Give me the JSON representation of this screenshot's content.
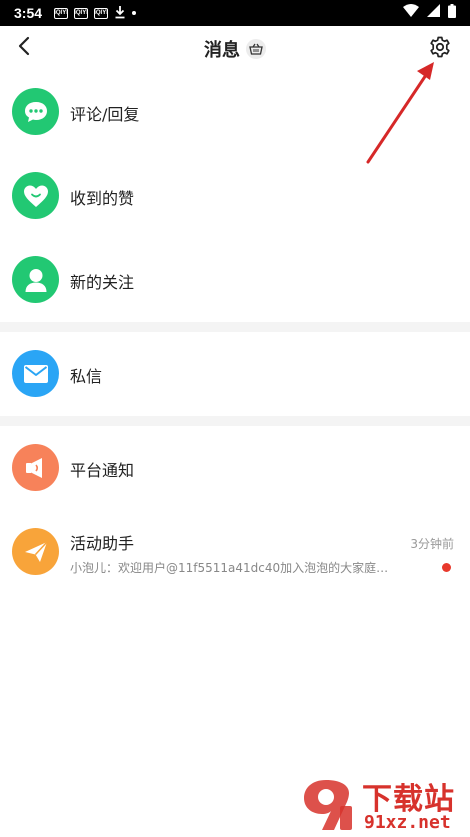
{
  "status_bar": {
    "time": "3:54",
    "app_icons": [
      "iQIYI",
      "iQIYI",
      "iQIYI"
    ],
    "download_icon": "download-icon",
    "icons": [
      "wifi-icon",
      "signal-icon",
      "battery-icon"
    ]
  },
  "header": {
    "title": "消息",
    "back_icon": "chevron-left-icon",
    "badge_icon": "basket-icon",
    "settings_icon": "gear-icon"
  },
  "rows": [
    {
      "label": "评论/回复",
      "icon": "comment-icon",
      "color": "#22c873"
    },
    {
      "label": "收到的赞",
      "icon": "heart-icon",
      "color": "#22c873"
    },
    {
      "label": "新的关注",
      "icon": "person-icon",
      "color": "#22c873"
    },
    {
      "label": "私信",
      "icon": "envelope-icon",
      "color": "#2aa5f5"
    },
    {
      "label": "平台通知",
      "icon": "megaphone-icon",
      "color": "#f7825a"
    },
    {
      "label": "活动助手",
      "icon": "paper-plane-icon",
      "color": "#f8a43a",
      "subtitle": "小泡儿：欢迎用户@11f5511a41dc40加入泡泡的大家庭，…",
      "time": "3分钟前",
      "unread": true
    }
  ],
  "watermark": {
    "title": "下载站",
    "url": "91xz.net"
  },
  "colors": {
    "accent_red": "#d7322c",
    "unread_dot": "#e8392c",
    "separator": "#f4f4f4"
  }
}
